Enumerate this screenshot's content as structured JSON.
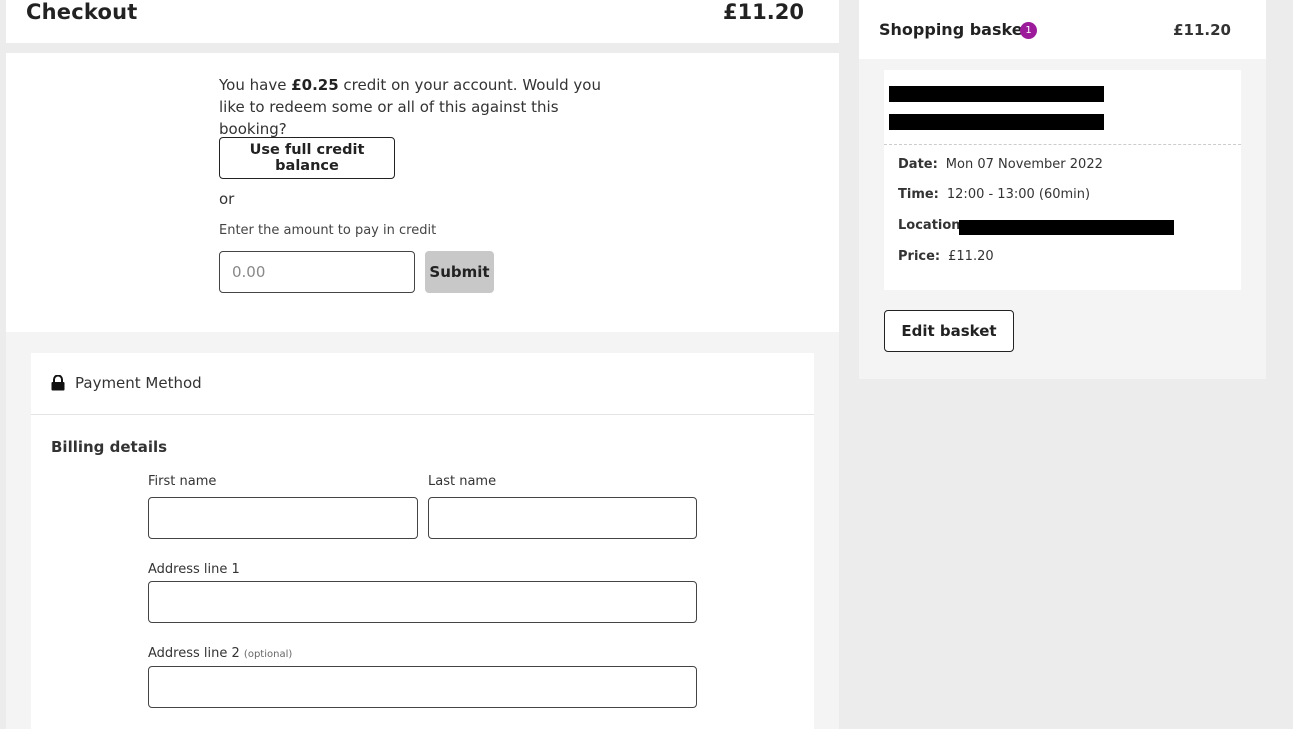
{
  "checkout": {
    "title": "Checkout",
    "total": "£11.20"
  },
  "credit": {
    "prefix": "You have ",
    "amount": "£0.25",
    "suffix": " credit on your account. Would you like to redeem some or all of this against this booking?",
    "use_full_label": "Use full credit balance",
    "or_label": "or",
    "amount_label": "Enter the amount to pay in credit",
    "amount_placeholder": "0.00",
    "submit_label": "Submit"
  },
  "payment": {
    "title": "Payment Method",
    "billing_title": "Billing details",
    "fields": {
      "first_name": "First name",
      "last_name": "Last name",
      "address1": "Address line 1",
      "address2": "Address line 2",
      "optional": "(optional)"
    }
  },
  "basket": {
    "title": "Shopping basket",
    "count": "1",
    "total": "£11.20",
    "item": {
      "date_key": "Date:",
      "date_val": "Mon 07 November 2022",
      "time_key": "Time:",
      "time_val": "12:00 - 13:00 (60min)",
      "location_key": "Location:",
      "price_key": "Price:",
      "price_val": "£11.20"
    },
    "edit_label": "Edit basket"
  },
  "colors": {
    "badge": "#9b1b9b",
    "submit_disabled": "#c8c8c8"
  },
  "icons": {
    "payment": "lock-icon"
  }
}
